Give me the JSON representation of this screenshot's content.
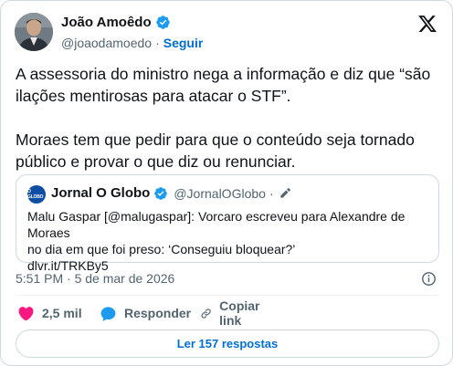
{
  "author": {
    "name": "João Amoêdo",
    "handle": "@joaodamoedo",
    "separator": "·",
    "follow_label": "Seguir"
  },
  "tweet": {
    "paragraph_1": "A assessoria do ministro nega a informação e diz que “são ilações mentirosas para atacar o STF”.",
    "paragraph_2": "Moraes tem que pedir para que o conteúdo seja tornado público e provar o que diz ou renunciar."
  },
  "quote": {
    "avatar_text": "O GLOBO",
    "name": "Jornal O Globo",
    "handle": "@JornalOGlobo",
    "separator": "·",
    "body_line_1": "Malu Gaspar [@malugaspar]: Vorcaro escreveu para Alexandre de Moraes",
    "body_line_2": "no dia em que foi preso: ‘Conseguiu bloquear?’",
    "link": "dlvr.it/TRKBy5"
  },
  "timestamp": "5:51 PM · 5 de mar de 2026",
  "actions": {
    "likes_count": "2,5 mil",
    "reply_label": "Responder",
    "copy_label": "Copiar link"
  },
  "read_replies_label": "Ler 157 respostas",
  "colors": {
    "accent": "#006fd6",
    "verified": "#1d9bf0",
    "like": "#f91880",
    "text": "#0f1419",
    "secondary": "#536471",
    "border": "#cfd9de"
  },
  "icons": [
    "verified-badge-icon",
    "x-logo-icon",
    "pencil-icon",
    "info-icon",
    "heart-icon",
    "speech-bubble-icon",
    "link-icon"
  ]
}
